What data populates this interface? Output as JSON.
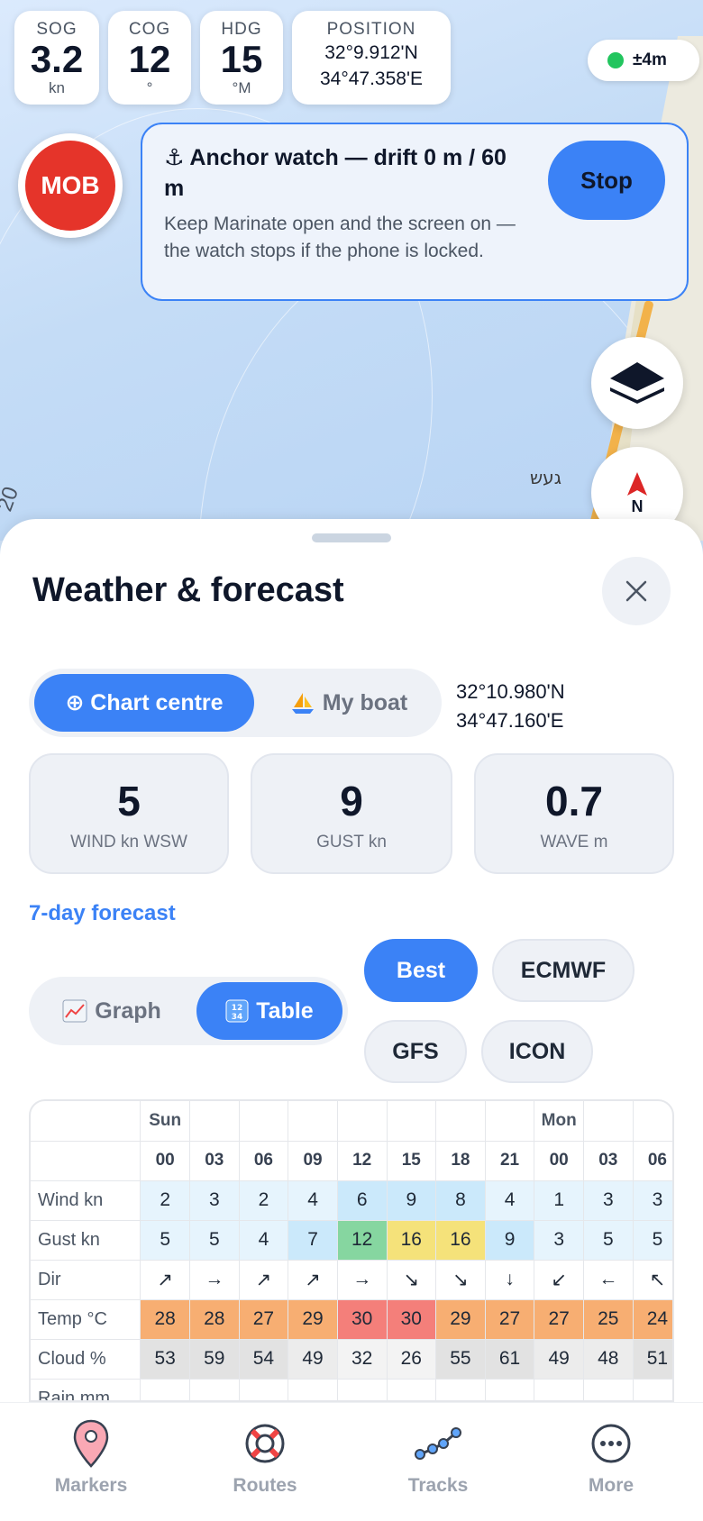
{
  "instruments": {
    "sog": {
      "label": "SOG",
      "value": "3.2",
      "unit": "kn"
    },
    "cog": {
      "label": "COG",
      "value": "12",
      "unit": "°"
    },
    "hdg": {
      "label": "HDG",
      "value": "15",
      "unit": "°M"
    },
    "position": {
      "label": "POSITION",
      "lat": "32°9.912'N",
      "lon": "34°47.358'E"
    }
  },
  "gps_accuracy": "±4m",
  "mob_label": "MOB",
  "map": {
    "town_label": "געש",
    "depth_label": "20"
  },
  "anchor_watch": {
    "title": "⚓ Anchor watch — drift 0 m / 60 m",
    "message": "Keep Marinate open and the screen on — the watch stops if the phone is locked.",
    "stop_label": "Stop"
  },
  "compass_letter": "N",
  "sheet": {
    "title": "Weather & forecast",
    "source_toggle": {
      "chart_centre": "⊕ Chart centre",
      "my_boat": "My boat",
      "selected": "chart_centre"
    },
    "coords": {
      "lat": "32°10.980'N",
      "lon": "34°47.160'E"
    },
    "cards": [
      {
        "value": "5",
        "label": "WIND kn WSW"
      },
      {
        "value": "9",
        "label": "GUST kn"
      },
      {
        "value": "0.7",
        "label": "WAVE m"
      }
    ],
    "forecast_link": "7-day forecast",
    "view_toggle": {
      "graph": "Graph",
      "table": "Table",
      "selected": "table"
    },
    "models": [
      {
        "label": "Best",
        "active": true
      },
      {
        "label": "ECMWF",
        "active": false
      },
      {
        "label": "GFS",
        "active": false
      },
      {
        "label": "ICON",
        "active": false
      }
    ]
  },
  "forecast_table": {
    "days": [
      "Sun",
      "",
      "",
      "",
      "",
      "",
      "",
      "",
      "Mon",
      "",
      ""
    ],
    "hours": [
      "00",
      "03",
      "06",
      "09",
      "12",
      "15",
      "18",
      "21",
      "00",
      "03",
      "06"
    ],
    "rows": [
      {
        "label": "Wind kn",
        "values": [
          "2",
          "3",
          "2",
          "4",
          "6",
          "9",
          "8",
          "4",
          "1",
          "3",
          "3"
        ],
        "colors": [
          "#e6f4fd",
          "#e6f4fd",
          "#e6f4fd",
          "#e6f4fd",
          "#cbe9fb",
          "#cbe9fb",
          "#cbe9fb",
          "#e6f4fd",
          "#e6f4fd",
          "#e6f4fd",
          "#e6f4fd"
        ]
      },
      {
        "label": "Gust kn",
        "values": [
          "5",
          "5",
          "4",
          "7",
          "12",
          "16",
          "16",
          "9",
          "3",
          "5",
          "5"
        ],
        "colors": [
          "#e6f4fd",
          "#e6f4fd",
          "#e6f4fd",
          "#cbe9fb",
          "#86d6a0",
          "#f5e27a",
          "#f5e27a",
          "#cbe9fb",
          "#e6f4fd",
          "#e6f4fd",
          "#e6f4fd"
        ]
      },
      {
        "label": "Dir",
        "values": [
          "↗",
          "→",
          "↗",
          "↗",
          "→",
          "↘",
          "↘",
          "↓",
          "↙",
          "←",
          "↖"
        ],
        "colors": [
          "#ffffff",
          "#ffffff",
          "#ffffff",
          "#ffffff",
          "#ffffff",
          "#ffffff",
          "#ffffff",
          "#ffffff",
          "#ffffff",
          "#ffffff",
          "#ffffff"
        ]
      },
      {
        "label": "Temp °C",
        "values": [
          "28",
          "28",
          "27",
          "29",
          "30",
          "30",
          "29",
          "27",
          "27",
          "25",
          "24"
        ],
        "colors": [
          "#f7ae72",
          "#f7ae72",
          "#f7ae72",
          "#f7ae72",
          "#f47f7a",
          "#f47f7a",
          "#f7ae72",
          "#f7ae72",
          "#f7ae72",
          "#f7ae72",
          "#f7ae72"
        ]
      },
      {
        "label": "Cloud %",
        "values": [
          "53",
          "59",
          "54",
          "49",
          "32",
          "26",
          "55",
          "61",
          "49",
          "48",
          "51"
        ],
        "colors": [
          "#e2e2e2",
          "#e2e2e2",
          "#e2e2e2",
          "#ececec",
          "#f3f3f3",
          "#f3f3f3",
          "#e2e2e2",
          "#e2e2e2",
          "#ececec",
          "#ececec",
          "#e2e2e2"
        ]
      },
      {
        "label": "Rain mm",
        "values": [
          "",
          "",
          "",
          "",
          "",
          "",
          "",
          "",
          "",
          "",
          ""
        ],
        "colors": [
          "#ffffff",
          "#ffffff",
          "#ffffff",
          "#ffffff",
          "#ffffff",
          "#ffffff",
          "#ffffff",
          "#ffffff",
          "#ffffff",
          "#ffffff",
          "#ffffff"
        ]
      }
    ]
  },
  "nav": [
    {
      "label": "Markers",
      "icon": "marker-pin-icon"
    },
    {
      "label": "Routes",
      "icon": "lifebuoy-icon"
    },
    {
      "label": "Tracks",
      "icon": "track-icon"
    },
    {
      "label": "More",
      "icon": "more-icon"
    }
  ]
}
